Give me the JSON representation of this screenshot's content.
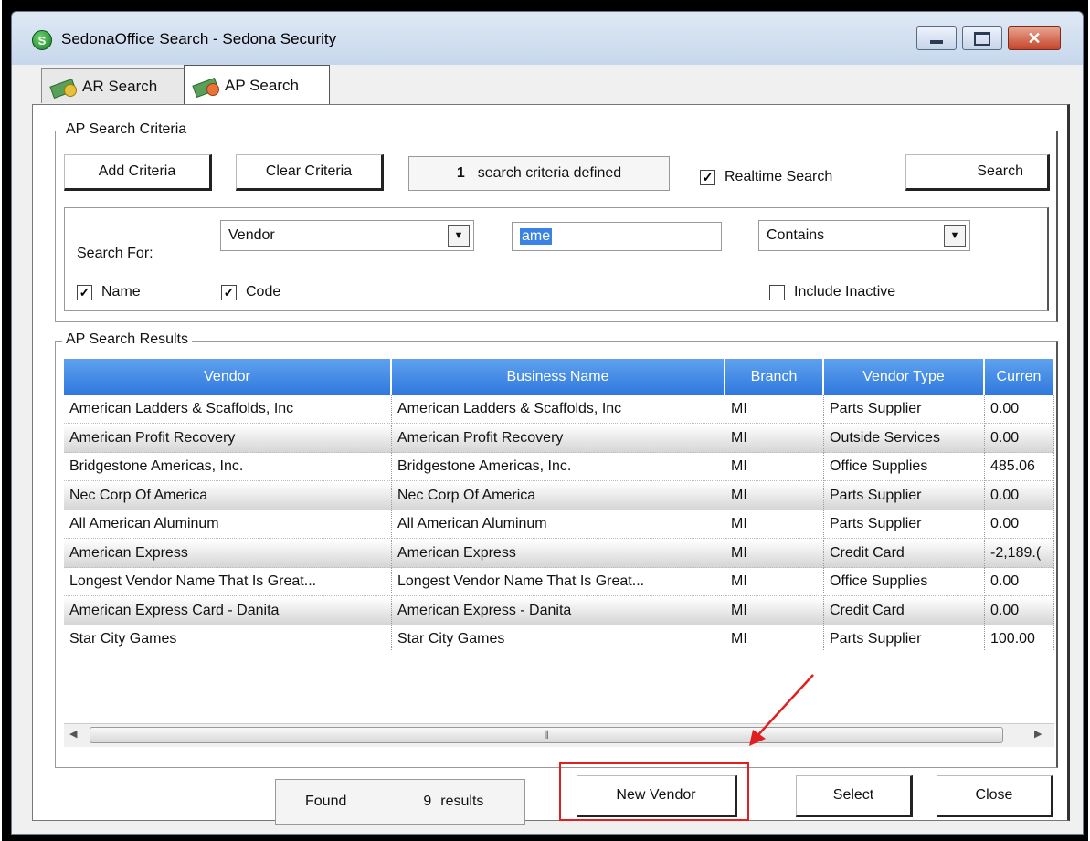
{
  "window": {
    "title": "SedonaOffice Search - Sedona Security",
    "app_icon_letter": "S"
  },
  "tabs": [
    {
      "label": "AR Search",
      "active": false
    },
    {
      "label": "AP Search",
      "active": true
    }
  ],
  "criteria": {
    "legend": "AP Search Criteria",
    "add_label": "Add Criteria",
    "clear_label": "Clear Criteria",
    "count": "1",
    "count_text": "search criteria defined",
    "realtime_label": "Realtime Search",
    "realtime_checked": true,
    "search_label": "Search",
    "search_for_label": "Search For:",
    "search_for_value": "Vendor",
    "text_value": "ame",
    "match_value": "Contains",
    "name_label": "Name",
    "code_label": "Code",
    "include_inactive_label": "Include Inactive"
  },
  "results": {
    "legend": "AP Search Results",
    "columns": [
      "Vendor",
      "Business Name",
      "Branch",
      "Vendor Type",
      "Curren"
    ],
    "rows": [
      [
        "American Ladders & Scaffolds, Inc",
        "American Ladders & Scaffolds, Inc",
        "MI",
        "Parts Supplier",
        "0.00"
      ],
      [
        "American Profit Recovery",
        "American Profit Recovery",
        "MI",
        "Outside Services",
        "0.00"
      ],
      [
        "Bridgestone Americas, Inc.",
        "Bridgestone Americas, Inc.",
        "MI",
        "Office Supplies",
        "485.06"
      ],
      [
        "Nec Corp Of America",
        "Nec Corp Of America",
        "MI",
        "Parts Supplier",
        "0.00"
      ],
      [
        "All American Aluminum",
        "All American Aluminum",
        "MI",
        "Parts Supplier",
        "0.00"
      ],
      [
        "American Express",
        "American Express",
        "MI",
        "Credit Card",
        "-2,189.("
      ],
      [
        "Longest Vendor Name That Is Great...",
        "Longest Vendor Name That Is Great...",
        "MI",
        "Office Supplies",
        "0.00"
      ],
      [
        "American Express Card - Danita",
        "American Express - Danita",
        "MI",
        "Credit Card",
        "0.00"
      ],
      [
        "Star City Games",
        "Star City Games",
        "MI",
        "Parts Supplier",
        "100.00"
      ]
    ]
  },
  "footer": {
    "found_label": "Found",
    "found_count": "9",
    "results_label": "results",
    "new_vendor_label": "New Vendor",
    "select_label": "Select",
    "close_label": "Close"
  },
  "colors": {
    "header_blue": "#3a82e4",
    "highlight_red": "#e02020"
  }
}
